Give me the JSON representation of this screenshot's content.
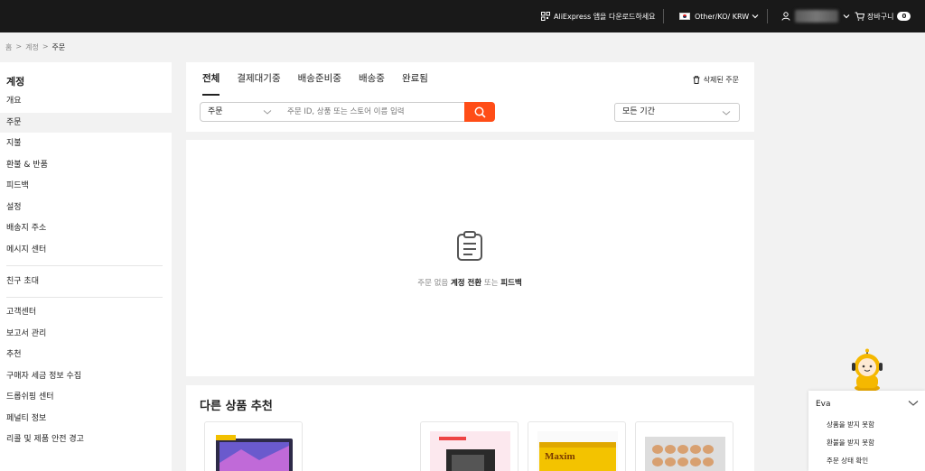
{
  "topbar": {
    "app_download": "AliExpress 앱을 다운로드하세요",
    "locale": "Other/KO/ KRW",
    "cart_label": "장바구니",
    "cart_count": "0"
  },
  "breadcrumb": [
    "홈",
    "계정",
    "주문"
  ],
  "sidebar": {
    "title": "계정",
    "items": [
      "개요",
      "주문",
      "지불",
      "환불 & 반품",
      "피드백",
      "설정",
      "배송지 주소",
      "메시지 센터"
    ],
    "group2": [
      "친구 초대"
    ],
    "group3": [
      "고객센터",
      "보고서 관리",
      "추천",
      "구매자 세금 정보 수집",
      "드롭쉬핑 센터",
      "페널티 정보",
      "리콜 및 제품 안전 경고"
    ],
    "active": "주문"
  },
  "orders": {
    "tabs": [
      "전체",
      "결제대기중",
      "배송준비중",
      "배송중",
      "완료됨"
    ],
    "deleted_label": "삭제된 주문",
    "filter_select": "주문",
    "search_placeholder": "주문 ID, 상품 또는 스토어 이름 입력",
    "period_select": "모든 기간",
    "empty_prefix": "주문 없음",
    "empty_link1": "계정 전환",
    "empty_mid": "또는",
    "empty_link2": "피드백"
  },
  "recommend": {
    "title": "다른 상품 추천",
    "product_brand": "Maxim"
  },
  "chat": {
    "agent": "Eva",
    "options": [
      "상품을 받지 못함",
      "환불을 받지 못함",
      "주문 상태 확인"
    ]
  },
  "colors": {
    "topbar": "#191919",
    "accent": "#ff4d17"
  }
}
